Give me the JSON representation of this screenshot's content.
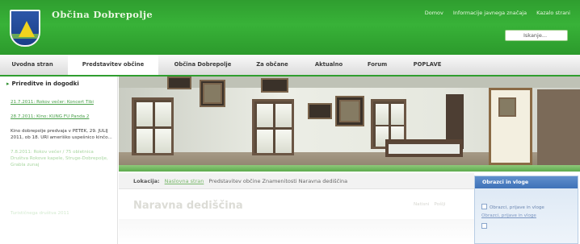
{
  "header": {
    "site_title": "Občina Dobrepolje",
    "top_links": [
      "Domov",
      "Informacije javnega značaja",
      "Kazalo strani"
    ],
    "search_placeholder": "Iskanje..."
  },
  "nav": {
    "items": [
      {
        "label": "Uvodna stran",
        "active": false
      },
      {
        "label": "Predstavitev občine",
        "active": true
      },
      {
        "label": "Občina Dobrepolje",
        "active": false
      },
      {
        "label": "Za občane",
        "active": false
      },
      {
        "label": "Aktualno",
        "active": false
      },
      {
        "label": "Forum",
        "active": false
      },
      {
        "label": "POPLAVE",
        "active": false
      }
    ]
  },
  "sidebar": {
    "title": "Prireditve in dogodki",
    "news": [
      {
        "text": "21.7.2011: Rokov večer: Koncert Tibi",
        "style": "link"
      },
      {
        "text": "28.7.2011: Kino: KUNG FU Panda 2",
        "style": "link"
      },
      {
        "text": "Kino dobrepolje predvaja v PETEK, 29. JULIJ 2011, ob 18. URI ameriško uspešnico kinčo...",
        "style": "plain"
      },
      {
        "text": "7.8.2011: Rokov večer / 75 obletnica Društva Rokove kapele, Struge-Dobrepolje, Grabla zunaj",
        "style": "faded"
      },
      {
        "text": "Turističnega društva 2011",
        "style": "faded2"
      }
    ]
  },
  "breadcrumb": {
    "label": "Lokacija:",
    "link": "Naslovna stran",
    "current": "Predstavitev občine Znamenitosti Naravna dediščina"
  },
  "content": {
    "title": "Naravna dediščina",
    "tools": [
      "Natisni",
      "Pošlji"
    ]
  },
  "right_box": {
    "title": "Obrazci in vloge",
    "items": [
      {
        "text": "Obrazci, prijave in vloge",
        "style": "icon"
      },
      {
        "text": "Obrazci, prijave in vloge",
        "style": "link"
      }
    ]
  },
  "colors": {
    "header_green": "#35a935",
    "nav_accent": "#2f9e2f",
    "link_green": "#49a049",
    "box_blue": "#4a7ec0"
  },
  "icons": [
    "municipality-crest",
    "search-icon",
    "document-icon"
  ]
}
